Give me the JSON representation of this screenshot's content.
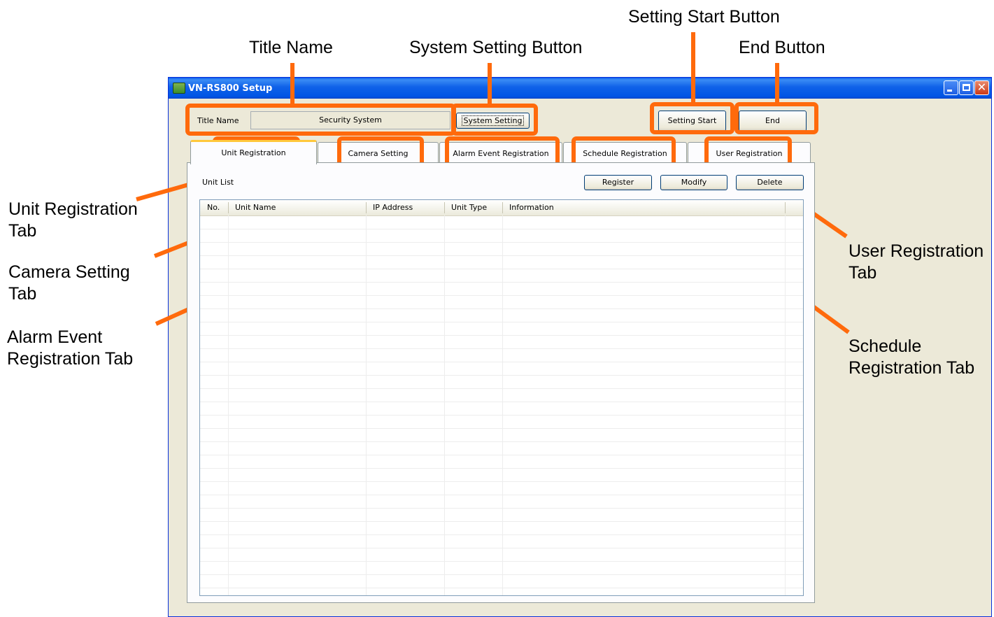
{
  "annotations": {
    "title_name": "Title  Name",
    "system_setting_button": "System Setting Button",
    "setting_start_button": "Setting Start Button",
    "end_button": "End Button",
    "unit_registration_tab": "Unit Registration  Tab",
    "camera_setting_tab": "Camera Setting Tab",
    "alarm_event_registration_tab": "Alarm Event Registration Tab",
    "user_registration_tab": "User Registration Tab",
    "schedule_registration_tab": "Schedule Registration Tab",
    "line_color": "#ff6a0c"
  },
  "window": {
    "title": "VN-RS800 Setup",
    "close_glyph": "✕",
    "icons": [
      "app-icon",
      "minimize-icon",
      "maximize-icon",
      "close-icon"
    ]
  },
  "toolbar": {
    "title_name_label": "Title Name",
    "title_name_value": "Security System",
    "system_setting_label": "System Setting",
    "setting_start_label": "Setting Start",
    "end_label": "End"
  },
  "tabs": [
    {
      "label": "Unit Registration",
      "selected": true
    },
    {
      "label": "Camera Setting",
      "selected": false
    },
    {
      "label": "Alarm Event Registration",
      "selected": false
    },
    {
      "label": "Schedule Registration",
      "selected": false
    },
    {
      "label": "User Registration",
      "selected": false
    }
  ],
  "unit_list": {
    "label": "Unit List",
    "register_label": "Register",
    "modify_label": "Modify",
    "delete_label": "Delete",
    "columns": [
      "No.",
      "Unit Name",
      "IP Address",
      "Unit Type",
      "Information"
    ],
    "rows": []
  }
}
